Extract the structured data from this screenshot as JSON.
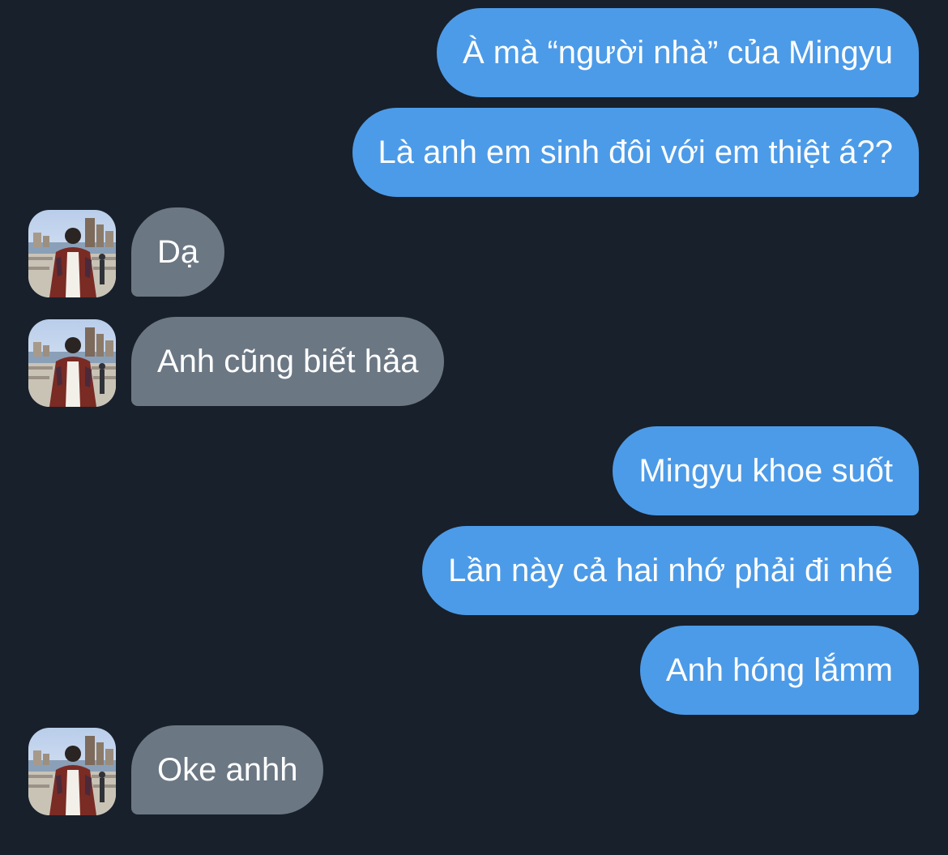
{
  "messages": [
    {
      "text": "À mà “người nhà” của Mingyu",
      "direction": "outgoing"
    },
    {
      "text": "Là anh em sinh đôi với em thiệt á??",
      "direction": "outgoing"
    },
    {
      "text": "Dạ",
      "direction": "incoming",
      "avatar": true
    },
    {
      "text": "Anh cũng biết hảa",
      "direction": "incoming",
      "avatar": true
    },
    {
      "text": "Mingyu khoe suốt",
      "direction": "outgoing"
    },
    {
      "text": "Lần này cả hai nhớ phải đi nhé",
      "direction": "outgoing"
    },
    {
      "text": "Anh hóng lắmm",
      "direction": "outgoing"
    },
    {
      "text": "Oke anhh",
      "direction": "incoming",
      "avatar": true
    }
  ],
  "colors": {
    "background": "#18202b",
    "outgoing_bubble": "#4c9be8",
    "incoming_bubble": "#6b7783",
    "text": "#ffffff"
  },
  "avatar_icon": "contact-photo"
}
